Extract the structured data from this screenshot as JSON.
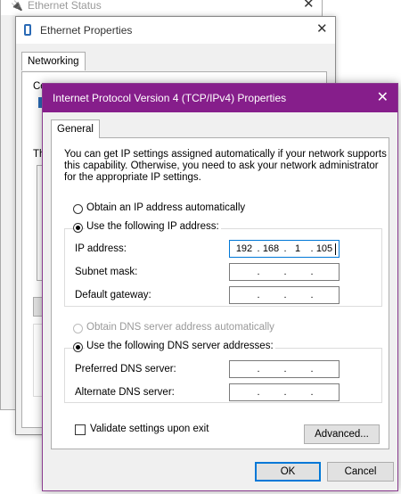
{
  "back_window": {
    "title": "Ethernet Status"
  },
  "props_window": {
    "title": "Ethernet Properties",
    "tab": "Networking",
    "partial_label_1": "Co",
    "partial_label_2": "Th"
  },
  "dialog": {
    "title": "Internet Protocol Version 4 (TCP/IPv4) Properties",
    "tab_general": "General",
    "description": [
      "You can get IP settings assigned automatically if your network supports",
      "this capability. Otherwise, you need to ask your network administrator",
      "for the appropriate IP settings."
    ],
    "obtain_ip_auto": "Obtain an IP address automatically",
    "use_following_ip": "Use the following IP address:",
    "ip_label": "IP address:",
    "subnet_label": "Subnet mask:",
    "gateway_label": "Default gateway:",
    "ip_value": [
      "192",
      "168",
      "1",
      "105"
    ],
    "obtain_dns_auto": "Obtain DNS server address automatically",
    "use_following_dns": "Use the following DNS server addresses:",
    "preferred_dns_label": "Preferred DNS server:",
    "alternate_dns_label": "Alternate DNS server:",
    "validate_label": "Validate settings upon exit",
    "advanced_button": "Advanced...",
    "ok_button": "OK",
    "cancel_button": "Cancel",
    "ip_dot": "."
  },
  "icons": {
    "network": "network-adapter-icon",
    "close": "close-icon"
  },
  "colors": {
    "accent": "#861e8b",
    "focus": "#0078d7"
  }
}
